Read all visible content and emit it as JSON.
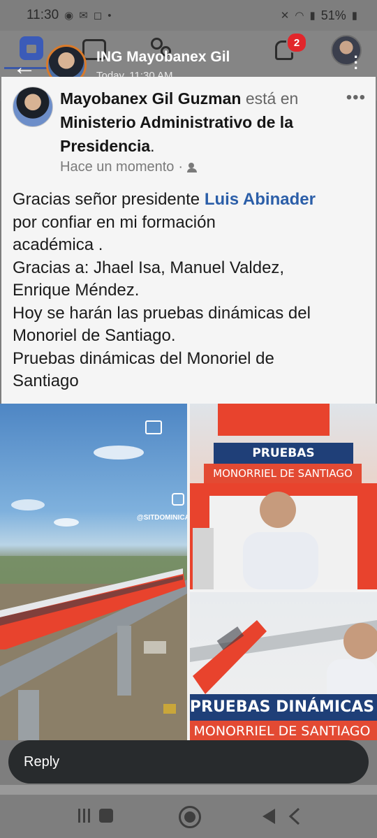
{
  "status_bar": {
    "time": "11:30",
    "battery": "51%"
  },
  "story": {
    "name": "ING Mayobanex Gil",
    "time": "Today, 11:30 AM"
  },
  "notifications": {
    "count": "2"
  },
  "post": {
    "author": "Mayobanex Gil Guzman",
    "is_at_word": "está",
    "in_word": "en",
    "location": "Ministerio Administrativo de la Presidencia",
    "location_suffix": ".",
    "timestamp": "Hace un momento",
    "meta_separator": "·",
    "lines": [
      {
        "before": "Gracias señor presidente ",
        "mention": "Luis Abinader"
      },
      {
        "text": "por confiar en mi formación"
      },
      {
        "text": "académica ."
      },
      {
        "text": "Gracias a: Jhael Isa, Manuel Valdez,"
      },
      {
        "text": "Enrique Méndez."
      },
      {
        "text": "Hoy se harán las pruebas dinámicas del"
      },
      {
        "text": "Monoriel de Santiago."
      },
      {
        "text": "Pruebas dinámicas del Monoriel de"
      },
      {
        "text": "Santiago"
      }
    ]
  },
  "media": {
    "left_watermark": "@SITDOMINICANA",
    "banner_top_title": "PRUEBAS DINÁMICAS",
    "banner_top_subtitle": "MONORRIEL DE SANTIAGO",
    "banner_bottom_title": "PRUEBAS DINÁMICAS",
    "banner_bottom_subtitle": "MONORRIEL DE SANTIAGO"
  },
  "reply": {
    "label": "Reply"
  },
  "colors": {
    "mention": "#2b5ea8",
    "badge_blue": "#1f3f78",
    "badge_red": "#e34a33",
    "notif": "#e2262b",
    "train": "#e8432d"
  }
}
